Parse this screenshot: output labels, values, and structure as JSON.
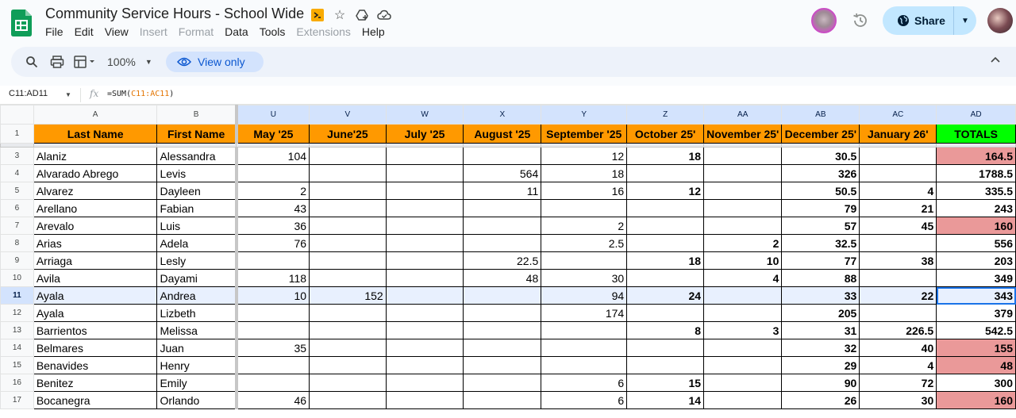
{
  "doc": {
    "title": "Community Service Hours - School Wide",
    "menu": [
      {
        "label": "File",
        "disabled": false
      },
      {
        "label": "Edit",
        "disabled": false
      },
      {
        "label": "View",
        "disabled": false
      },
      {
        "label": "Insert",
        "disabled": true
      },
      {
        "label": "Format",
        "disabled": true
      },
      {
        "label": "Data",
        "disabled": false
      },
      {
        "label": "Tools",
        "disabled": false
      },
      {
        "label": "Extensions",
        "disabled": true
      },
      {
        "label": "Help",
        "disabled": false
      }
    ],
    "share_label": "Share"
  },
  "toolbar": {
    "zoom": "100%",
    "view_only_label": "View only"
  },
  "formula_bar": {
    "name_box": "C11:AD11",
    "fx": "fx",
    "formula_prefix": "=SUM(",
    "formula_ref": "C11:AC11",
    "formula_suffix": ")"
  },
  "columns": [
    "A",
    "B",
    "U",
    "V",
    "W",
    "X",
    "Y",
    "Z",
    "AA",
    "AB",
    "AC",
    "AD"
  ],
  "header_row": {
    "row_number": "1",
    "cells": [
      "Last Name",
      "First Name",
      "May '25",
      "June'25",
      "July '25",
      "August '25",
      "September '25",
      "October 25'",
      "November 25'",
      "December 25'",
      "January 26'",
      "TOTALS"
    ]
  },
  "rows": [
    {
      "n": "3",
      "last": "Alaniz",
      "first": "Alessandra",
      "vals": [
        "104",
        "",
        "",
        "",
        "12",
        "18",
        "",
        "30.5",
        "",
        "164.5"
      ],
      "pink": true
    },
    {
      "n": "4",
      "last": "Alvarado Abrego",
      "first": "Levis",
      "vals": [
        "",
        "",
        "",
        "564",
        "18",
        "",
        "",
        "326",
        "",
        "1788.5"
      ],
      "pink": false
    },
    {
      "n": "5",
      "last": "Alvarez",
      "first": "Dayleen",
      "vals": [
        "2",
        "",
        "",
        "11",
        "16",
        "12",
        "",
        "50.5",
        "4",
        "335.5"
      ],
      "pink": false
    },
    {
      "n": "6",
      "last": "Arellano",
      "first": "Fabian",
      "vals": [
        "43",
        "",
        "",
        "",
        "",
        "",
        "",
        "79",
        "21",
        "243"
      ],
      "pink": false
    },
    {
      "n": "7",
      "last": "Arevalo",
      "first": "Luis",
      "vals": [
        "36",
        "",
        "",
        "",
        "2",
        "",
        "",
        "57",
        "45",
        "160"
      ],
      "pink": true
    },
    {
      "n": "8",
      "last": "Arias",
      "first": "Adela",
      "vals": [
        "76",
        "",
        "",
        "",
        "2.5",
        "",
        "2",
        "32.5",
        "",
        "556"
      ],
      "pink": false
    },
    {
      "n": "9",
      "last": "Arriaga",
      "first": "Lesly",
      "vals": [
        "",
        "",
        "",
        "22.5",
        "",
        "18",
        "10",
        "77",
        "38",
        "203"
      ],
      "pink": false
    },
    {
      "n": "10",
      "last": "Avila",
      "first": "Dayami",
      "vals": [
        "118",
        "",
        "",
        "48",
        "30",
        "",
        "4",
        "88",
        "",
        "349"
      ],
      "pink": false
    },
    {
      "n": "11",
      "last": "Ayala",
      "first": "Andrea",
      "vals": [
        "10",
        "152",
        "",
        "",
        "94",
        "24",
        "",
        "33",
        "22",
        "343"
      ],
      "pink": false,
      "selected": true
    },
    {
      "n": "12",
      "last": "Ayala",
      "first": "Lizbeth",
      "vals": [
        "",
        "",
        "",
        "",
        "174",
        "",
        "",
        "205",
        "",
        "379"
      ],
      "pink": false
    },
    {
      "n": "13",
      "last": "Barrientos",
      "first": "Melissa",
      "vals": [
        "",
        "",
        "",
        "",
        "",
        "8",
        "3",
        "31",
        "226.5",
        "542.5"
      ],
      "pink": false
    },
    {
      "n": "14",
      "last": "Belmares",
      "first": "Juan",
      "vals": [
        "35",
        "",
        "",
        "",
        "",
        "",
        "",
        "32",
        "40",
        "155"
      ],
      "pink": true
    },
    {
      "n": "15",
      "last": "Benavides",
      "first": "Henry",
      "vals": [
        "",
        "",
        "",
        "",
        "",
        "",
        "",
        "29",
        "4",
        "48"
      ],
      "pink": true
    },
    {
      "n": "16",
      "last": "Benitez",
      "first": "Emily",
      "vals": [
        "",
        "",
        "",
        "",
        "6",
        "15",
        "",
        "90",
        "72",
        "300"
      ],
      "pink": false
    },
    {
      "n": "17",
      "last": "Bocanegra",
      "first": "Orlando",
      "vals": [
        "46",
        "",
        "",
        "",
        "6",
        "14",
        "",
        "26",
        "30",
        "160"
      ],
      "pink": true
    }
  ],
  "colors": {
    "header_orange": "#ff9900",
    "totals_green": "#00ff00",
    "low_total_pink": "#ea9999",
    "selection_blue": "#d3e3fd",
    "share_blue": "#c2e7ff"
  }
}
